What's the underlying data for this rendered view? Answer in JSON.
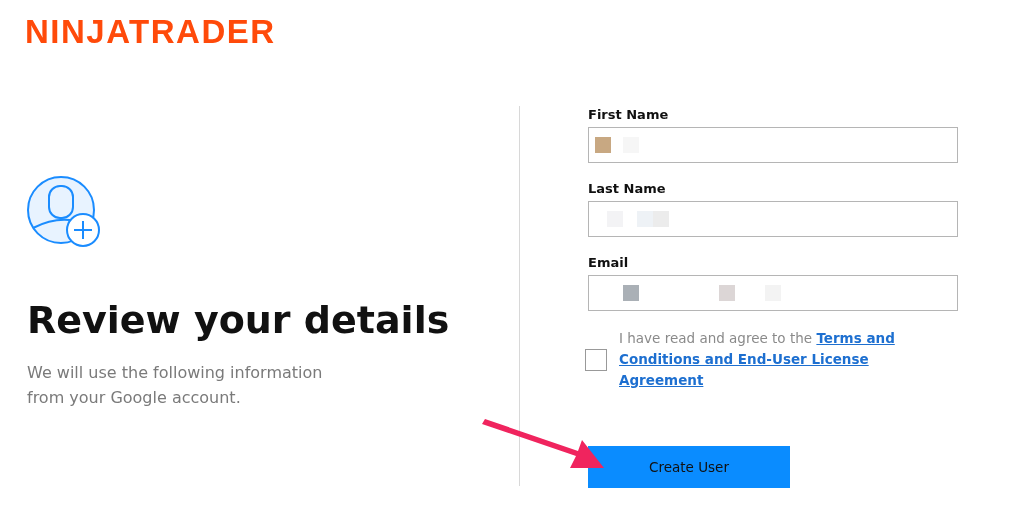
{
  "logo": "NINJATRADER",
  "heading": "Review your details",
  "subtitle": "We will use the following information from your Google account.",
  "fields": [
    {
      "label": "First Name"
    },
    {
      "label": "Last Name"
    },
    {
      "label": "Email"
    }
  ],
  "agreement": {
    "checked": false,
    "text": "I have read and agree to the",
    "link_lines": [
      "Terms and",
      "Conditions and End-User License",
      "Agreement"
    ]
  },
  "submit_button": "Create User"
}
